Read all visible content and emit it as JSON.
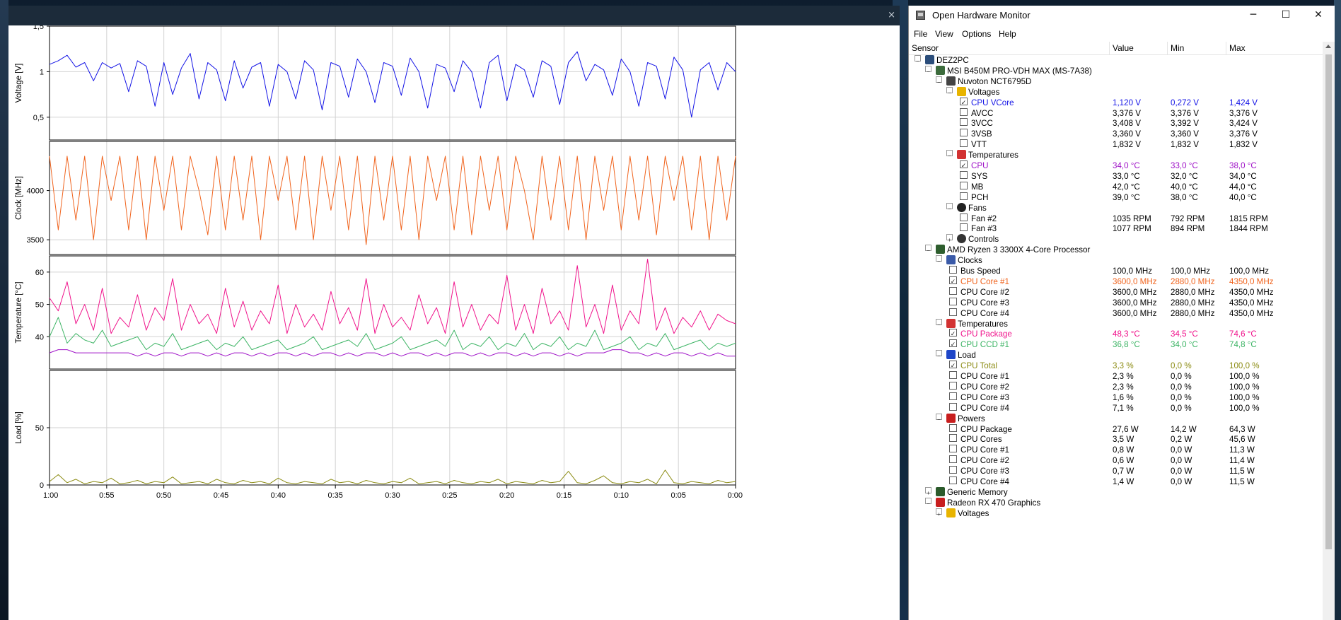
{
  "plot_window": {
    "close_glyph": "×",
    "xticks": [
      "1:00",
      "0:55",
      "0:50",
      "0:45",
      "0:40",
      "0:35",
      "0:30",
      "0:25",
      "0:20",
      "0:15",
      "0:10",
      "0:05",
      "0:00"
    ]
  },
  "chart_data": [
    {
      "type": "line",
      "ylabel": "Voltage [V]",
      "yticks": [
        "1,5",
        "1",
        "0,5"
      ],
      "ylim": [
        0.25,
        1.5
      ],
      "x_unit": "minutes ago (1:00 to 0:00)",
      "series": [
        {
          "name": "CPU VCore",
          "color": "#1414e6",
          "values": [
            1.08,
            1.12,
            1.18,
            1.05,
            1.1,
            0.9,
            1.1,
            1.04,
            1.09,
            0.78,
            1.12,
            1.06,
            0.62,
            1.1,
            0.75,
            1.04,
            1.2,
            0.7,
            1.1,
            1.02,
            0.68,
            1.12,
            0.82,
            1.05,
            1.1,
            0.62,
            1.08,
            1.0,
            0.7,
            1.12,
            1.02,
            0.58,
            1.1,
            1.06,
            0.72,
            1.14,
            1.0,
            0.66,
            1.1,
            1.06,
            0.74,
            1.15,
            1.0,
            0.6,
            1.08,
            1.04,
            0.78,
            1.12,
            1.0,
            0.6,
            1.1,
            1.18,
            0.68,
            1.08,
            1.02,
            0.72,
            1.12,
            1.06,
            0.64,
            1.1,
            1.22,
            0.9,
            1.08,
            1.02,
            0.74,
            1.14,
            1.0,
            0.62,
            1.1,
            1.06,
            0.7,
            1.16,
            1.02,
            0.5,
            1.02,
            1.1,
            0.8,
            1.1,
            1.0
          ]
        }
      ]
    },
    {
      "type": "line",
      "ylabel": "Clock [MHz]",
      "yticks": [
        "4000",
        "3500"
      ],
      "ylim": [
        3350,
        4500
      ],
      "series": [
        {
          "name": "CPU Core #1",
          "color": "#f0641e",
          "values": [
            4350,
            3600,
            4350,
            3700,
            4350,
            3500,
            4350,
            3900,
            4350,
            3600,
            4350,
            3500,
            4350,
            3800,
            4350,
            3600,
            4350,
            4000,
            3550,
            4350,
            3600,
            4350,
            3700,
            4350,
            3500,
            4350,
            3900,
            4350,
            3600,
            4350,
            3500,
            4350,
            3800,
            4350,
            3600,
            4350,
            3450,
            4350,
            3700,
            4350,
            3600,
            4350,
            3500,
            4350,
            3900,
            4350,
            3600,
            4350,
            3550,
            4350,
            3800,
            4350,
            3600,
            4350,
            4000,
            3500,
            4350,
            3700,
            4350,
            3600,
            4350,
            3500,
            4350,
            3800,
            4350,
            3600,
            4350,
            3700,
            4350,
            3550,
            4350,
            3900,
            4350,
            3600,
            4350,
            3500,
            4350,
            3700,
            4350
          ]
        }
      ]
    },
    {
      "type": "line",
      "ylabel": "Temperature [°C]",
      "yticks": [
        "60",
        "50",
        "40"
      ],
      "ylim": [
        30,
        65
      ],
      "series": [
        {
          "name": "CPU Package",
          "color": "#f0148c",
          "values": [
            52,
            48,
            57,
            44,
            50,
            42,
            55,
            41,
            46,
            43,
            53,
            42,
            49,
            45,
            58,
            42,
            50,
            44,
            47,
            41,
            55,
            43,
            51,
            42,
            48,
            44,
            56,
            41,
            50,
            43,
            47,
            42,
            54,
            44,
            49,
            42,
            58,
            41,
            50,
            43,
            46,
            42,
            53,
            44,
            49,
            41,
            57,
            43,
            50,
            42,
            47,
            44,
            59,
            42,
            50,
            41,
            55,
            44,
            48,
            42,
            62,
            43,
            50,
            41,
            56,
            42,
            48,
            44,
            64,
            42,
            49,
            41,
            46,
            43,
            48,
            42,
            47,
            45,
            44
          ]
        },
        {
          "name": "CPU CCD #1",
          "color": "#3cb464",
          "values": [
            40,
            46,
            38,
            41,
            39,
            38,
            42,
            37,
            38,
            39,
            40,
            36,
            38,
            37,
            41,
            36,
            37,
            38,
            39,
            36,
            38,
            37,
            40,
            36,
            37,
            38,
            39,
            36,
            37,
            38,
            40,
            36,
            37,
            38,
            39,
            37,
            41,
            36,
            37,
            38,
            40,
            36,
            37,
            38,
            39,
            37,
            42,
            36,
            38,
            37,
            40,
            36,
            38,
            37,
            41,
            36,
            38,
            37,
            40,
            36,
            38,
            37,
            42,
            36,
            37,
            38,
            40,
            36,
            38,
            37,
            41,
            36,
            37,
            38,
            39,
            36,
            38,
            37,
            38
          ]
        },
        {
          "name": "CPU",
          "color": "#a014c8",
          "values": [
            35,
            36,
            36,
            35,
            35,
            35,
            35,
            35,
            35,
            35,
            34,
            35,
            34,
            35,
            35,
            34,
            35,
            35,
            34,
            35,
            34,
            35,
            35,
            34,
            35,
            34,
            35,
            35,
            34,
            35,
            34,
            35,
            35,
            34,
            35,
            34,
            35,
            35,
            34,
            35,
            34,
            35,
            35,
            34,
            35,
            34,
            35,
            35,
            34,
            35,
            34,
            35,
            35,
            34,
            35,
            34,
            35,
            35,
            34,
            35,
            34,
            35,
            35,
            35,
            36,
            36,
            35,
            35,
            34,
            35,
            34,
            35,
            35,
            34,
            35,
            34,
            35,
            34,
            34
          ]
        }
      ]
    },
    {
      "type": "line",
      "ylabel": "Load [%]",
      "yticks": [
        "50",
        "0"
      ],
      "ylim": [
        0,
        100
      ],
      "series": [
        {
          "name": "CPU Total",
          "color": "#8c8c14",
          "values": [
            3,
            9,
            2,
            5,
            1,
            3,
            2,
            6,
            1,
            2,
            4,
            1,
            3,
            2,
            7,
            1,
            2,
            3,
            1,
            5,
            2,
            1,
            4,
            2,
            3,
            1,
            6,
            2,
            1,
            3,
            2,
            1,
            5,
            2,
            3,
            1,
            4,
            2,
            1,
            3,
            2,
            6,
            1,
            2,
            3,
            1,
            4,
            2,
            1,
            3,
            2,
            5,
            1,
            3,
            2,
            1,
            4,
            2,
            3,
            12,
            2,
            1,
            4,
            8,
            2,
            1,
            3,
            2,
            5,
            1,
            13,
            2,
            1,
            3,
            2,
            1,
            4,
            2,
            3
          ]
        }
      ]
    }
  ],
  "ohm": {
    "title": "Open Hardware Monitor",
    "buttons": {
      "minimize": "─",
      "maximize": "☐",
      "close": "✕"
    },
    "menu": [
      "File",
      "View",
      "Options",
      "Help"
    ],
    "columns": {
      "sensor": "Sensor",
      "value": "Value",
      "min": "Min",
      "max": "Max"
    },
    "rows": [
      {
        "level": 0,
        "exp": "−",
        "icon": "pc-icon",
        "label": "DEZ2PC"
      },
      {
        "level": 1,
        "exp": "−",
        "icon": "motherboard-icon",
        "label": "MSI B450M PRO-VDH MAX (MS-7A38)"
      },
      {
        "level": 2,
        "exp": "−",
        "icon": "chip-icon",
        "label": "Nuvoton NCT6795D"
      },
      {
        "level": 3,
        "exp": "−",
        "icon": "voltage-icon",
        "label": "Voltages"
      },
      {
        "level": 4,
        "chk": true,
        "label": "CPU VCore",
        "value": "1,120 V",
        "min": "0,272 V",
        "max": "1,424 V",
        "color": "#1414e6"
      },
      {
        "level": 4,
        "chk": false,
        "label": "AVCC",
        "value": "3,376 V",
        "min": "3,376 V",
        "max": "3,376 V"
      },
      {
        "level": 4,
        "chk": false,
        "label": "3VCC",
        "value": "3,408 V",
        "min": "3,392 V",
        "max": "3,424 V"
      },
      {
        "level": 4,
        "chk": false,
        "label": "3VSB",
        "value": "3,360 V",
        "min": "3,360 V",
        "max": "3,376 V"
      },
      {
        "level": 4,
        "chk": false,
        "label": "VTT",
        "value": "1,832 V",
        "min": "1,832 V",
        "max": "1,832 V"
      },
      {
        "level": 3,
        "exp": "−",
        "icon": "thermometer-icon",
        "label": "Temperatures"
      },
      {
        "level": 4,
        "chk": true,
        "label": "CPU",
        "value": "34,0 °C",
        "min": "33,0 °C",
        "max": "38,0 °C",
        "color": "#a014c8"
      },
      {
        "level": 4,
        "chk": false,
        "label": "SYS",
        "value": "33,0 °C",
        "min": "32,0 °C",
        "max": "34,0 °C"
      },
      {
        "level": 4,
        "chk": false,
        "label": "MB",
        "value": "42,0 °C",
        "min": "40,0 °C",
        "max": "44,0 °C"
      },
      {
        "level": 4,
        "chk": false,
        "label": "PCH",
        "value": "39,0 °C",
        "min": "38,0 °C",
        "max": "40,0 °C"
      },
      {
        "level": 3,
        "exp": "−",
        "icon": "fan-icon",
        "label": "Fans"
      },
      {
        "level": 4,
        "chk": false,
        "label": "Fan #2",
        "value": "1035 RPM",
        "min": "792 RPM",
        "max": "1815 RPM"
      },
      {
        "level": 4,
        "chk": false,
        "label": "Fan #3",
        "value": "1077 RPM",
        "min": "894 RPM",
        "max": "1844 RPM"
      },
      {
        "level": 3,
        "exp": "+",
        "icon": "controls-icon",
        "label": "Controls"
      },
      {
        "level": 1,
        "exp": "−",
        "icon": "cpu-icon",
        "label": "AMD Ryzen 3 3300X 4-Core Processor"
      },
      {
        "level": 2,
        "exp": "−",
        "icon": "clock-icon",
        "label": "Clocks"
      },
      {
        "level": 3,
        "chk": false,
        "label": "Bus Speed",
        "value": "100,0 MHz",
        "min": "100,0 MHz",
        "max": "100,0 MHz"
      },
      {
        "level": 3,
        "chk": true,
        "label": "CPU Core #1",
        "value": "3600,0 MHz",
        "min": "2880,0 MHz",
        "max": "4350,0 MHz",
        "color": "#f0641e"
      },
      {
        "level": 3,
        "chk": false,
        "label": "CPU Core #2",
        "value": "3600,0 MHz",
        "min": "2880,0 MHz",
        "max": "4350,0 MHz"
      },
      {
        "level": 3,
        "chk": false,
        "label": "CPU Core #3",
        "value": "3600,0 MHz",
        "min": "2880,0 MHz",
        "max": "4350,0 MHz"
      },
      {
        "level": 3,
        "chk": false,
        "label": "CPU Core #4",
        "value": "3600,0 MHz",
        "min": "2880,0 MHz",
        "max": "4350,0 MHz"
      },
      {
        "level": 2,
        "exp": "−",
        "icon": "thermometer-icon",
        "label": "Temperatures"
      },
      {
        "level": 3,
        "chk": true,
        "label": "CPU Package",
        "value": "48,3 °C",
        "min": "34,5 °C",
        "max": "74,6 °C",
        "color": "#f0148c"
      },
      {
        "level": 3,
        "chk": true,
        "label": "CPU CCD #1",
        "value": "36,8 °C",
        "min": "34,0 °C",
        "max": "74,8 °C",
        "color": "#3cb464"
      },
      {
        "level": 2,
        "exp": "−",
        "icon": "load-icon",
        "label": "Load"
      },
      {
        "level": 3,
        "chk": true,
        "label": "CPU Total",
        "value": "3,3 %",
        "min": "0,0 %",
        "max": "100,0 %",
        "color": "#8c8c14"
      },
      {
        "level": 3,
        "chk": false,
        "label": "CPU Core #1",
        "value": "2,3 %",
        "min": "0,0 %",
        "max": "100,0 %"
      },
      {
        "level": 3,
        "chk": false,
        "label": "CPU Core #2",
        "value": "2,3 %",
        "min": "0,0 %",
        "max": "100,0 %"
      },
      {
        "level": 3,
        "chk": false,
        "label": "CPU Core #3",
        "value": "1,6 %",
        "min": "0,0 %",
        "max": "100,0 %"
      },
      {
        "level": 3,
        "chk": false,
        "label": "CPU Core #4",
        "value": "7,1 %",
        "min": "0,0 %",
        "max": "100,0 %"
      },
      {
        "level": 2,
        "exp": "−",
        "icon": "power-icon",
        "label": "Powers"
      },
      {
        "level": 3,
        "chk": false,
        "label": "CPU Package",
        "value": "27,6 W",
        "min": "14,2 W",
        "max": "64,3 W"
      },
      {
        "level": 3,
        "chk": false,
        "label": "CPU Cores",
        "value": "3,5 W",
        "min": "0,2 W",
        "max": "45,6 W"
      },
      {
        "level": 3,
        "chk": false,
        "label": "CPU Core #1",
        "value": "0,8 W",
        "min": "0,0 W",
        "max": "11,3 W"
      },
      {
        "level": 3,
        "chk": false,
        "label": "CPU Core #2",
        "value": "0,6 W",
        "min": "0,0 W",
        "max": "11,4 W"
      },
      {
        "level": 3,
        "chk": false,
        "label": "CPU Core #3",
        "value": "0,7 W",
        "min": "0,0 W",
        "max": "11,5 W"
      },
      {
        "level": 3,
        "chk": false,
        "label": "CPU Core #4",
        "value": "1,4 W",
        "min": "0,0 W",
        "max": "11,5 W"
      },
      {
        "level": 1,
        "exp": "+",
        "icon": "memory-icon",
        "label": "Generic Memory"
      },
      {
        "level": 1,
        "exp": "−",
        "icon": "gpu-icon",
        "label": "Radeon RX 470 Graphics"
      },
      {
        "level": 2,
        "exp": "+",
        "icon": "voltage-icon",
        "label": "Voltages"
      }
    ]
  }
}
